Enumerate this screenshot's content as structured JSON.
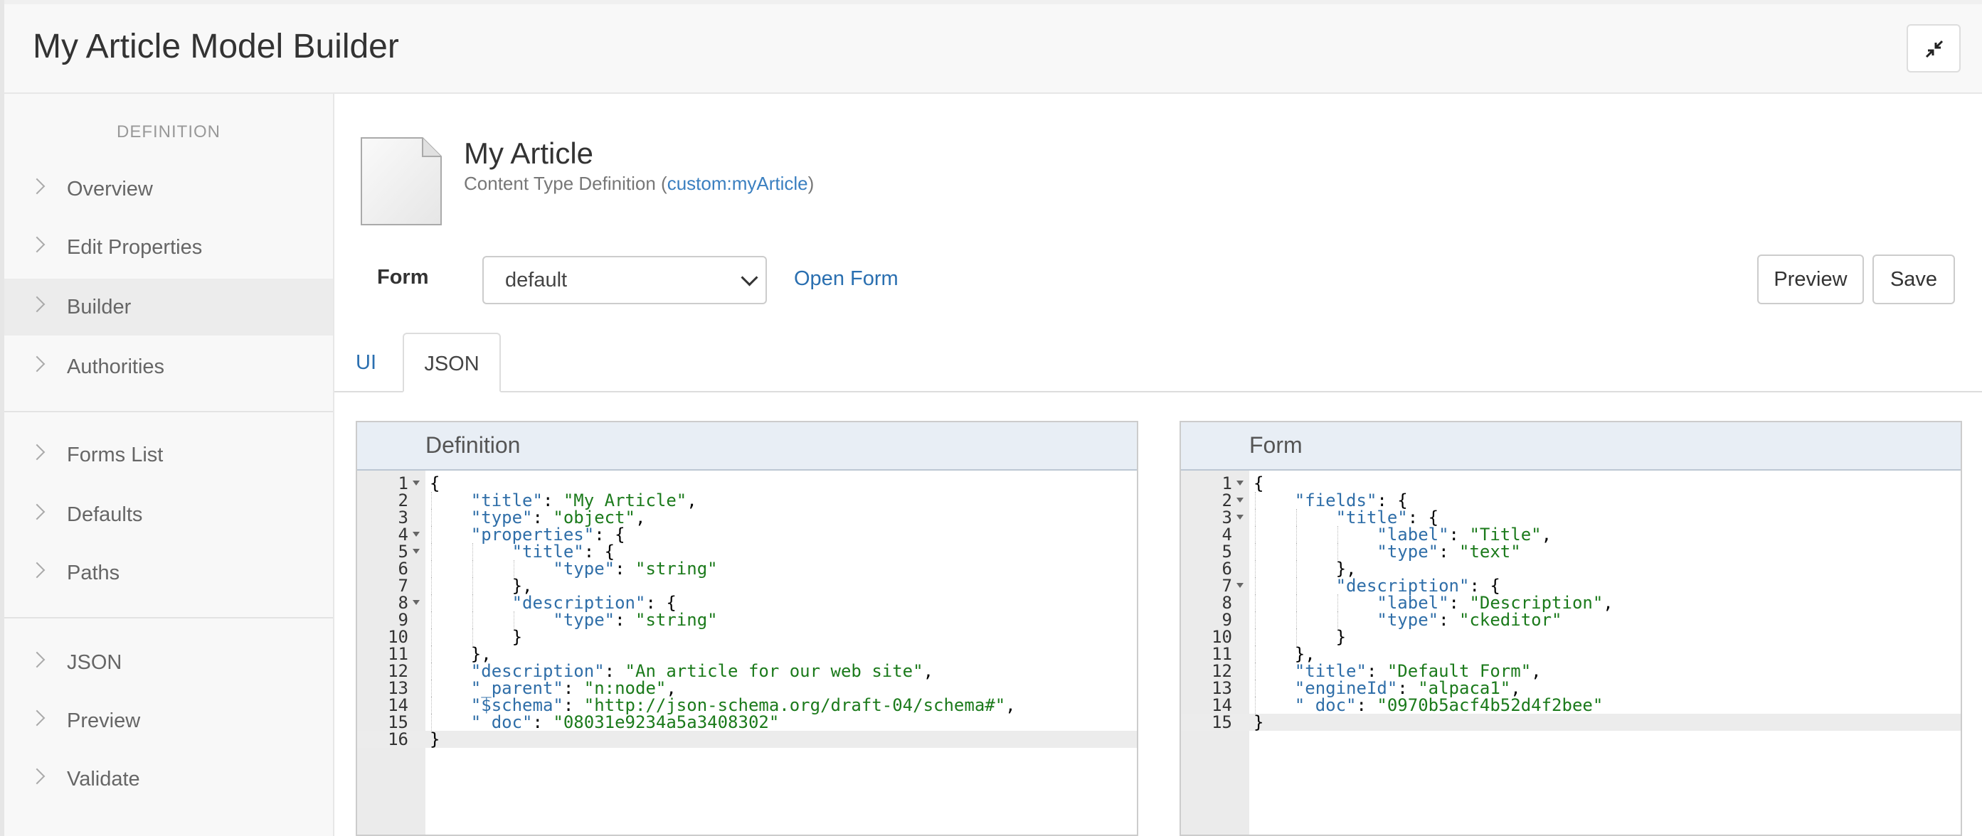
{
  "header": {
    "title": "My Article Model Builder"
  },
  "sidebar": {
    "heading": "DEFINITION",
    "items": [
      {
        "label": "Overview"
      },
      {
        "label": "Edit Properties"
      },
      {
        "label": "Builder"
      },
      {
        "label": "Authorities"
      },
      {
        "label": "Forms List"
      },
      {
        "label": "Defaults"
      },
      {
        "label": "Paths"
      },
      {
        "label": "JSON"
      },
      {
        "label": "Preview"
      },
      {
        "label": "Validate"
      }
    ],
    "active_item": "Builder"
  },
  "type_info": {
    "title": "My Article",
    "subtitle_prefix": "Content Type Definition (",
    "qname": "custom:myArticle",
    "subtitle_suffix": ")"
  },
  "form_bar": {
    "label": "Form",
    "select_value": "default",
    "open_form": "Open Form",
    "preview": "Preview",
    "save": "Save"
  },
  "tabs": [
    {
      "label": "UI"
    },
    {
      "label": "JSON"
    }
  ],
  "active_tab": "JSON",
  "editors": {
    "definition": {
      "title": "Definition",
      "active_line": 16,
      "fold_lines": [
        1,
        4,
        5,
        8
      ],
      "lines": [
        "{",
        "    \"title\": \"My Article\",",
        "    \"type\": \"object\",",
        "    \"properties\": {",
        "        \"title\": {",
        "            \"type\": \"string\"",
        "        },",
        "        \"description\": {",
        "            \"type\": \"string\"",
        "        }",
        "    },",
        "    \"description\": \"An article for our web site\",",
        "    \"_parent\": \"n:node\",",
        "    \"$schema\": \"http://json-schema.org/draft-04/schema#\",",
        "    \"_doc\": \"08031e9234a5a3408302\"",
        "}"
      ]
    },
    "form": {
      "title": "Form",
      "active_line": 15,
      "fold_lines": [
        1,
        2,
        3,
        7
      ],
      "lines": [
        "{",
        "    \"fields\": {",
        "        \"title\": {",
        "            \"label\": \"Title\",",
        "            \"type\": \"text\"",
        "        },",
        "        \"description\": {",
        "            \"label\": \"Description\",",
        "            \"type\": \"ckeditor\"",
        "        }",
        "    },",
        "    \"title\": \"Default Form\",",
        "    \"engineId\": \"alpaca1\",",
        "    \"_doc\": \"0970b5acf4b52d4f2bee\"",
        "}"
      ]
    }
  },
  "colors": {
    "link": "#2a6fb0",
    "json_key": "#2f6ea8",
    "json_string": "#1b7a1b",
    "editor_header": "#e8eef5"
  }
}
